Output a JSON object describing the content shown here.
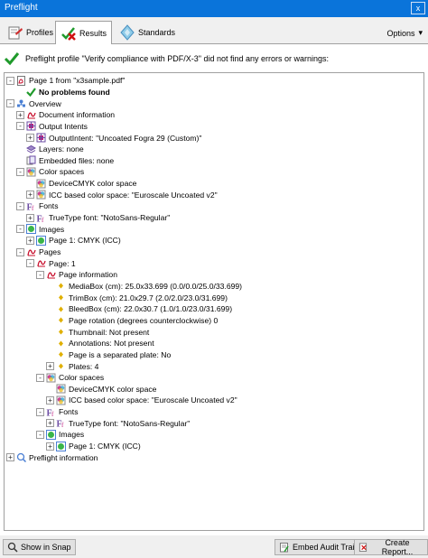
{
  "window": {
    "title": "Preflight",
    "close_label": "x"
  },
  "tabs": [
    {
      "label": "Profiles",
      "icon": "profiles-icon"
    },
    {
      "label": "Results",
      "icon": "results-icon"
    },
    {
      "label": "Standards",
      "icon": "standards-icon"
    }
  ],
  "options_label": "Options",
  "summary_text": "Preflight profile \"Verify compliance with PDF/X-3\" did not find any errors or warnings:",
  "tree": [
    {
      "text": "Page 1 from \"x3sample.pdf\"",
      "level": 0,
      "exp": "-",
      "icon": "pdf-page-icon"
    },
    {
      "text": "No problems found",
      "level": 1,
      "exp": "",
      "icon": "checkmark-icon",
      "bold": true
    },
    {
      "text": "Overview",
      "level": 0,
      "exp": "-",
      "icon": "overview-icon"
    },
    {
      "text": "Document information",
      "level": 1,
      "exp": "+",
      "icon": "pdf-icon"
    },
    {
      "text": "Output Intents",
      "level": 1,
      "exp": "-",
      "icon": "output-intent-icon"
    },
    {
      "text": "OutputIntent: \"Uncoated Fogra 29 (Custom)\"",
      "level": 2,
      "exp": "+",
      "icon": "output-intent-icon"
    },
    {
      "text": "Layers: none",
      "level": 1,
      "exp": "",
      "icon": "layers-icon"
    },
    {
      "text": "Embedded files: none",
      "level": 1,
      "exp": "",
      "icon": "embedded-files-icon"
    },
    {
      "text": "Color spaces",
      "level": 1,
      "exp": "-",
      "icon": "color-space-icon"
    },
    {
      "text": "DeviceCMYK color space",
      "level": 2,
      "exp": "",
      "icon": "color-space-icon"
    },
    {
      "text": "ICC based color space: \"Euroscale Uncoated v2\"",
      "level": 2,
      "exp": "+",
      "icon": "color-space-icon"
    },
    {
      "text": "Fonts",
      "level": 1,
      "exp": "-",
      "icon": "font-icon"
    },
    {
      "text": "TrueType font: \"NotoSans-Regular\"",
      "level": 2,
      "exp": "+",
      "icon": "font-icon"
    },
    {
      "text": "Images",
      "level": 1,
      "exp": "-",
      "icon": "image-icon"
    },
    {
      "text": "Page 1: CMYK (ICC)",
      "level": 2,
      "exp": "+",
      "icon": "image-icon"
    },
    {
      "text": "Pages",
      "level": 1,
      "exp": "-",
      "icon": "pdf-icon"
    },
    {
      "text": "Page: 1",
      "level": 2,
      "exp": "-",
      "icon": "pdf-icon"
    },
    {
      "text": "Page information",
      "level": 3,
      "exp": "-",
      "icon": "pdf-icon"
    },
    {
      "text": "MediaBox (cm): 25.0x33.699 (0.0/0.0/25.0/33.699)",
      "level": 4,
      "exp": "",
      "icon": "bullet-icon"
    },
    {
      "text": "TrimBox (cm): 21.0x29.7 (2.0/2.0/23.0/31.699)",
      "level": 4,
      "exp": "",
      "icon": "bullet-icon"
    },
    {
      "text": "BleedBox (cm): 22.0x30.7 (1.0/1.0/23.0/31.699)",
      "level": 4,
      "exp": "",
      "icon": "bullet-icon"
    },
    {
      "text": "Page rotation (degrees counterclockwise) 0",
      "level": 4,
      "exp": "",
      "icon": "bullet-icon"
    },
    {
      "text": "Thumbnail: Not present",
      "level": 4,
      "exp": "",
      "icon": "bullet-icon"
    },
    {
      "text": "Annotations: Not present",
      "level": 4,
      "exp": "",
      "icon": "bullet-icon"
    },
    {
      "text": "Page is a separated plate: No",
      "level": 4,
      "exp": "",
      "icon": "bullet-icon"
    },
    {
      "text": "Plates: 4",
      "level": 4,
      "exp": "+",
      "icon": "bullet-icon"
    },
    {
      "text": "Color spaces",
      "level": 3,
      "exp": "-",
      "icon": "color-space-icon"
    },
    {
      "text": "DeviceCMYK color space",
      "level": 4,
      "exp": "",
      "icon": "color-space-icon"
    },
    {
      "text": "ICC based color space: \"Euroscale Uncoated v2\"",
      "level": 4,
      "exp": "+",
      "icon": "color-space-icon"
    },
    {
      "text": "Fonts",
      "level": 3,
      "exp": "-",
      "icon": "font-icon"
    },
    {
      "text": "TrueType font: \"NotoSans-Regular\"",
      "level": 4,
      "exp": "+",
      "icon": "font-icon"
    },
    {
      "text": "Images",
      "level": 3,
      "exp": "-",
      "icon": "image-icon"
    },
    {
      "text": "Page 1: CMYK (ICC)",
      "level": 4,
      "exp": "+",
      "icon": "image-icon"
    },
    {
      "text": "Preflight information",
      "level": 0,
      "exp": "+",
      "icon": "preflight-info-icon"
    }
  ],
  "buttons": {
    "show_in_snap": "Show in Snap",
    "embed_audit_trail": "Embed Audit Trail...",
    "create_report": "Create Report..."
  },
  "colors": {
    "titlebar": "#0a74da",
    "check_green": "#1f9a2b",
    "pdf_red": "#c8102e"
  }
}
